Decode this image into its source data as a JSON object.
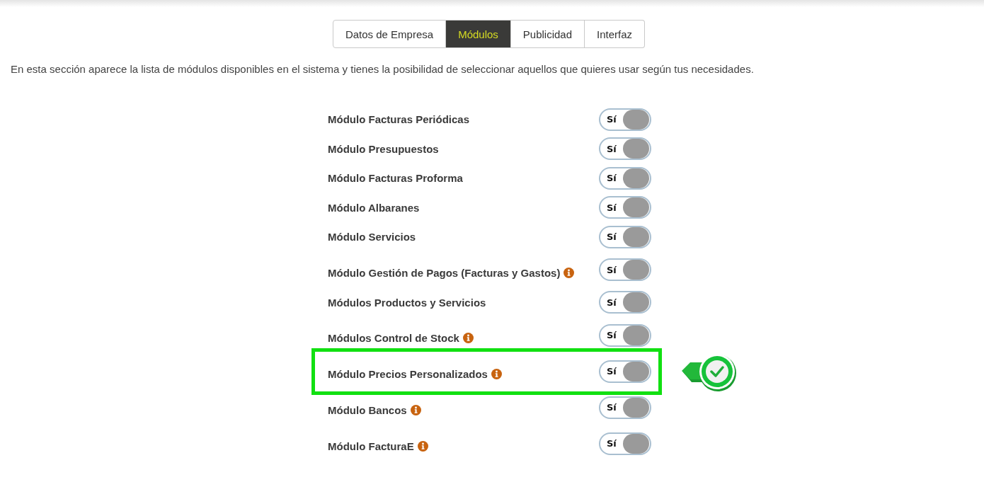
{
  "tabs": [
    {
      "label": "Datos de Empresa",
      "selected": false
    },
    {
      "label": "Módulos",
      "selected": true
    },
    {
      "label": "Publicidad",
      "selected": false
    },
    {
      "label": "Interfaz",
      "selected": false
    }
  ],
  "description": "En esta sección aparece la lista de módulos disponibles en el sistema y tienes la posibilidad de seleccionar aquellos que quieres usar según tus necesidades.",
  "modules": [
    {
      "label": "Módulo Facturas Periódicas",
      "info": false,
      "highlighted": false,
      "toggle": {
        "text": "Sí",
        "on": true
      }
    },
    {
      "label": "Módulo Presupuestos",
      "info": false,
      "highlighted": false,
      "toggle": {
        "text": "Sí",
        "on": true
      }
    },
    {
      "label": "Módulo Facturas Proforma",
      "info": false,
      "highlighted": false,
      "toggle": {
        "text": "Sí",
        "on": true
      }
    },
    {
      "label": "Módulo Albaranes",
      "info": false,
      "highlighted": false,
      "toggle": {
        "text": "Sí",
        "on": true
      }
    },
    {
      "label": "Módulo Servicios",
      "info": false,
      "highlighted": false,
      "toggle": {
        "text": "Sí",
        "on": true
      }
    },
    {
      "label": "Módulo Gestión de Pagos (Facturas y Gastos)",
      "info": true,
      "highlighted": false,
      "toggle": {
        "text": "Sí",
        "on": true
      }
    },
    {
      "label": "Módulos Productos y Servicios",
      "info": false,
      "highlighted": false,
      "toggle": {
        "text": "Sí",
        "on": true
      }
    },
    {
      "label": "Módulos Control de Stock",
      "info": true,
      "highlighted": false,
      "toggle": {
        "text": "Sí",
        "on": true
      }
    },
    {
      "label": "Módulo Precios Personalizados",
      "info": true,
      "highlighted": true,
      "toggle": {
        "text": "Sí",
        "on": true
      }
    },
    {
      "label": "Módulo Bancos",
      "info": true,
      "highlighted": false,
      "toggle": {
        "text": "Sí",
        "on": true
      }
    },
    {
      "label": "Módulo FacturaE",
      "info": true,
      "highlighted": false,
      "toggle": {
        "text": "Sí",
        "on": true
      }
    }
  ]
}
